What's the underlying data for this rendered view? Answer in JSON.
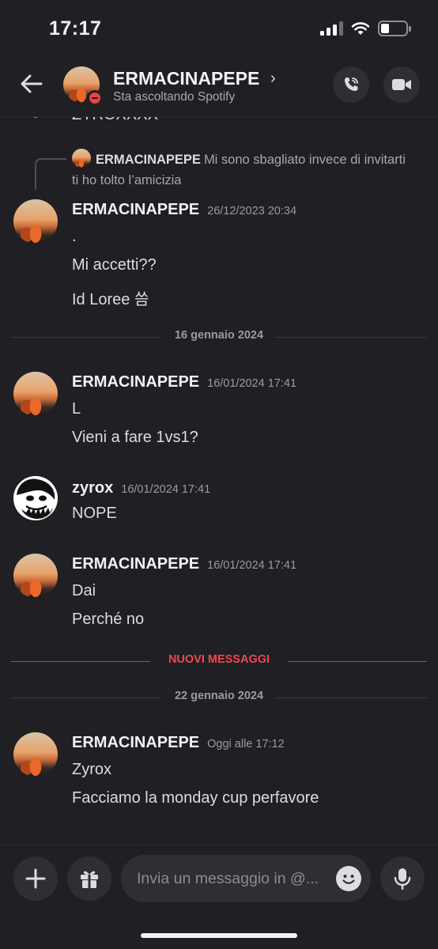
{
  "status_bar": {
    "time": "17:17"
  },
  "header": {
    "name": "ERMACINAPEPE",
    "chevron": "›",
    "status": "Sta ascoltando Spotify",
    "icons": [
      "back-arrow-icon",
      "phone-call-icon",
      "video-camera-icon"
    ]
  },
  "cut_message": {
    "text": "ZYROXXXX"
  },
  "reply": {
    "name": "ERMACINAPEPE",
    "text": "Mi sono sbagliato invece di invitarti ti ho tolto l’amicizia"
  },
  "messages": [
    {
      "author": "ERMACINAPEPE",
      "time": "26/12/2023 20:34",
      "avatar": "car",
      "lines": [
        ".",
        "Mi accetti??",
        "Id Loree 씀"
      ]
    },
    {
      "author": "ERMACINAPEPE",
      "time": "16/01/2024 17:41",
      "avatar": "car",
      "lines": [
        "L",
        "Vieni a fare 1vs1?"
      ]
    },
    {
      "author": "zyrox",
      "time": "16/01/2024 17:41",
      "avatar": "joker",
      "lines": [
        "NOPE"
      ]
    },
    {
      "author": "ERMACINAPEPE",
      "time": "16/01/2024 17:41",
      "avatar": "car",
      "lines": [
        "Dai",
        "Perché no"
      ]
    },
    {
      "author": "ERMACINAPEPE",
      "time": "Oggi alle 17:12",
      "avatar": "car",
      "lines": [
        "Zyrox",
        "Facciamo la monday cup perfavore"
      ]
    }
  ],
  "dividers": {
    "date1": "16 gennaio 2024",
    "new_messages": "NUOVI MESSAGGI",
    "date2": "22 gennaio 2024"
  },
  "composer": {
    "placeholder": "Invia un messaggio in @...",
    "icons": [
      "plus-icon",
      "gift-icon",
      "emoji-icon",
      "microphone-icon"
    ]
  },
  "colors": {
    "background": "#1f1f24",
    "dnd_red": "#f23f43",
    "new_messages_red": "#f0474b"
  }
}
